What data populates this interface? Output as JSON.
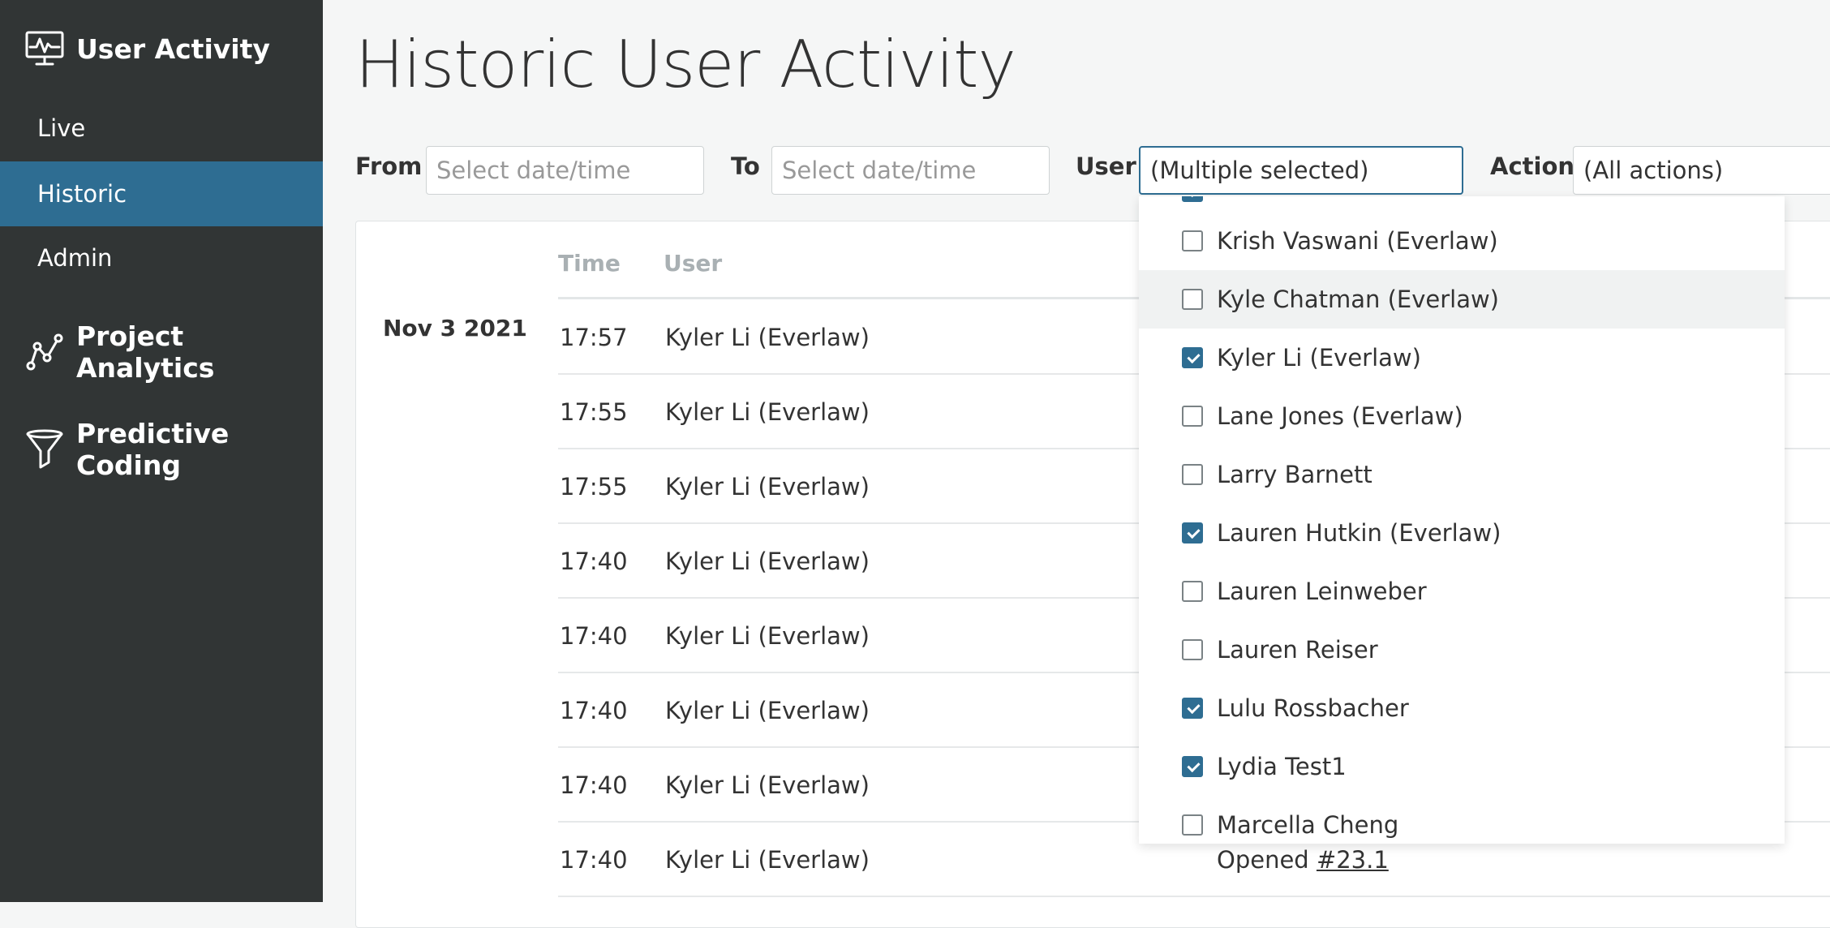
{
  "sidebar": {
    "user_activity": {
      "title": "User Activity",
      "icon": "monitor-activity-icon"
    },
    "nav": [
      {
        "label": "Live",
        "active": false
      },
      {
        "label": "Historic",
        "active": true
      },
      {
        "label": "Admin",
        "active": false
      }
    ],
    "project_analytics": {
      "title": "Project Analytics",
      "icon": "line-graph-icon"
    },
    "predictive_coding": {
      "title": "Predictive Coding",
      "icon": "funnel-icon"
    }
  },
  "page": {
    "title": "Historic User Activity"
  },
  "filters": {
    "from_label": "From",
    "from_placeholder": "Select date/time",
    "to_label": "To",
    "to_placeholder": "Select date/time",
    "user_label": "User",
    "user_value": "(Multiple selected)",
    "action_label": "Action",
    "action_value": "(All actions)"
  },
  "table": {
    "headers": {
      "time": "Time",
      "user": "User"
    },
    "date": "Nov 3 2021",
    "rows": [
      {
        "time": "17:57",
        "user": "Kyler Li (Everlaw)"
      },
      {
        "time": "17:55",
        "user": "Kyler Li (Everlaw)"
      },
      {
        "time": "17:55",
        "user": "Kyler Li (Everlaw)"
      },
      {
        "time": "17:40",
        "user": "Kyler Li (Everlaw)"
      },
      {
        "time": "17:40",
        "user": "Kyler Li (Everlaw)"
      },
      {
        "time": "17:40",
        "user": "Kyler Li (Everlaw)"
      },
      {
        "time": "17:40",
        "user": "Kyler Li (Everlaw)"
      },
      {
        "time": "17:40",
        "user": "Kyler Li (Everlaw)",
        "action": "Opened",
        "action_link": "#23.1"
      }
    ]
  },
  "user_dropdown": {
    "options": [
      {
        "label": "Krish Vaswani (Everlaw)",
        "checked": false
      },
      {
        "label": "Kyle Chatman (Everlaw)",
        "checked": false,
        "hover": true
      },
      {
        "label": "Kyler Li (Everlaw)",
        "checked": true
      },
      {
        "label": "Lane Jones (Everlaw)",
        "checked": false
      },
      {
        "label": "Larry Barnett",
        "checked": false
      },
      {
        "label": "Lauren Hutkin (Everlaw)",
        "checked": true
      },
      {
        "label": "Lauren Leinweber",
        "checked": false
      },
      {
        "label": "Lauren Reiser",
        "checked": false
      },
      {
        "label": "Lulu Rossbacher",
        "checked": true
      },
      {
        "label": "Lydia Test1",
        "checked": true
      },
      {
        "label": "Marcella Cheng",
        "checked": false
      }
    ]
  },
  "colors": {
    "sidebar_bg": "#313535",
    "accent": "#2e6d92"
  }
}
